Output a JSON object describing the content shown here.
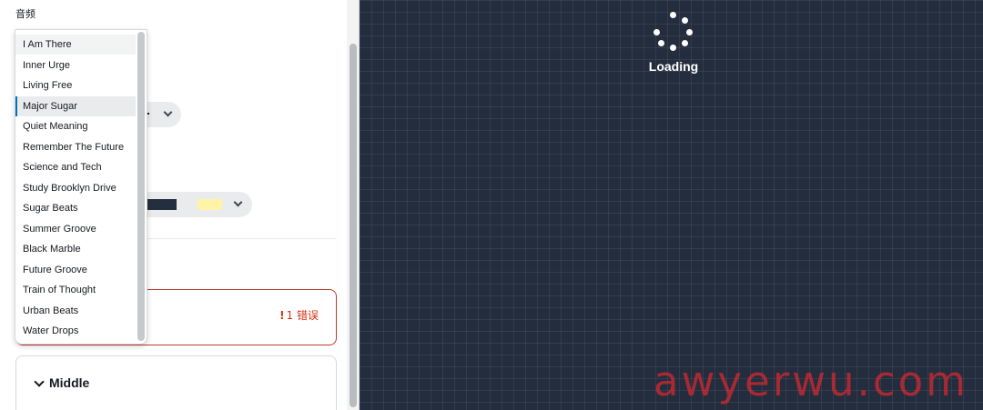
{
  "panel": {
    "section_title": "音频",
    "error_badge": "1 错误",
    "error_mark": "!",
    "middle_title": "Middle"
  },
  "dropdown": {
    "items": [
      "I Am There",
      "Inner Urge",
      "Living Free",
      "Major Sugar",
      "Quiet Meaning",
      "Remember The Future",
      "Science and Tech",
      "Study Brooklyn Drive",
      "Sugar Beats",
      "Summer Groove",
      "Black Marble",
      "Future Groove",
      "Train of Thought",
      "Urban Beats",
      "Water Drops"
    ],
    "hovered_index": 0,
    "selected_index": 3
  },
  "canvas": {
    "loading_text": "Loading"
  },
  "watermark": "awyerwu.com",
  "colors": {
    "canvas_bg": "#242d3d",
    "selected_accent": "#0073bb",
    "error": "#d13212"
  }
}
